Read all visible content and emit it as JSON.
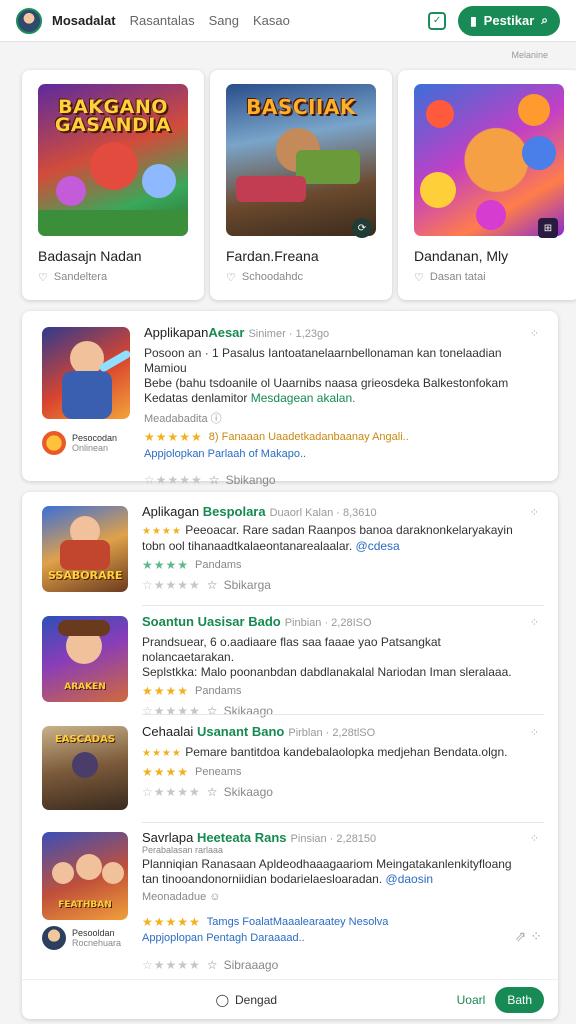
{
  "header": {
    "brand": "Mosadalat",
    "nav": [
      "Rasantalas",
      "Sang",
      "Kasao"
    ],
    "cta_label": "Pestikar"
  },
  "corner_note": "Melanine",
  "featured": [
    {
      "art_title": "BAKGANO\nGASANDIA",
      "name": "Badasajn Nadan",
      "sub": "Sandeltera"
    },
    {
      "art_title": "BASCIIAK",
      "name": "Fardan.Freana",
      "sub": "Schoodahdc"
    },
    {
      "art_title": "",
      "name": "Dandanan, Mly",
      "sub": "Dasan tatai"
    }
  ],
  "item1": {
    "title": "Applikapan",
    "accent": "Aesar",
    "meta": "Sinimer · 1,23go",
    "desc1": "Posoon an · 1 Pasalus Iantoatanelaarnbellonaman kan tonelaadian Mamiou",
    "desc2": "Bebe (bahu tsdoanile ol Uaarnibs naasa grieosdeka Balkestonfokam",
    "desc3a": "Kedatas denlamitor",
    "desc3b": "Mesdagean akalan.",
    "sub": "Meadabadita",
    "rating_text": "8) Fanaaan Uaadetkadanbaanay Angali..",
    "blue": "Appjolopkan Parlaah of Makapo..",
    "foot": "Sbikango"
  },
  "list": [
    {
      "title": "Aplikagan",
      "accent": "Bespolara",
      "meta": "Duaorl Kalan · 8,3610",
      "desc1": "Peeoacar. Rare sadan Raanpos banoa daraknonkelaryakayin",
      "desc2a": "tobn ool tihanaadtkalaeontanarealaalar.",
      "desc2b": "@cdesa",
      "rating_text": "Pandams",
      "foot": "Sbikarga",
      "thumb_label": "SSABORARE"
    },
    {
      "title": "",
      "accent": "Soantun Uasisar Bado",
      "meta": "Pinbian · 2,28ISO",
      "desc1": "Prandsuear, 6 o.aadiaare flas saa faaae yao Patsangkat nolancaetarakan.",
      "desc2": "Seplstkka: Malo poonanbdan dabdlanakalal Nariodan Iman sleralaaa.",
      "rating_text": "Pandams",
      "foot": "Skikaago",
      "thumb_label": "ARAKEN"
    },
    {
      "title": "Cehaalai",
      "accent": "Usanant Bano",
      "meta": "Pirblan · 2,28tlSO",
      "desc1": "Pemare bantitdoa kandebalaolopka medjehan Bendata.olgn.",
      "desc2": "",
      "rating_text": "Peneams",
      "foot": "Skikaago",
      "thumb_label": "EASCADAS"
    },
    {
      "title": "Savrlapa",
      "accent": "Heeteata Rans",
      "meta": "Pinsian · 2,28150",
      "desc0": "Perabalasan rarlaaa",
      "desc1": "Planniqian Ranasaan Apldeodhaaagaariom Meingatakanlenkityfloang",
      "desc2a": "tan tinooandonorniidian bodarielaesloaradan.",
      "desc2b": "@daosin",
      "sub": "Meonadadue",
      "rating_text": "Tamgs FoalatMaaalearaatey Nesolva",
      "blue": "Appjoplopan Pentagh Daraaaad..",
      "foot": "Sibraaago",
      "thumb_label": "FEATHBAN"
    }
  ],
  "mini_user_1": {
    "name": "Pesocodan",
    "sub": "Onlinean"
  },
  "mini_user_2": {
    "name": "Pesooldan",
    "sub": "Rocnehuara"
  },
  "bottom": {
    "center": "Dengad",
    "link": "Uoarl",
    "button": "Bath"
  }
}
